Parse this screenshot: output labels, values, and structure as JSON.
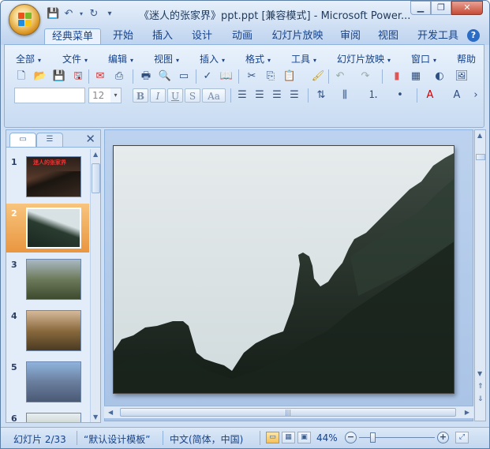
{
  "window": {
    "title": "《迷人的张家界》ppt.ppt [兼容模式] - Microsoft Power...",
    "controls": [
      "minimize-icon",
      "restore-icon",
      "close-icon"
    ]
  },
  "ribbon_tabs": [
    "经典菜单",
    "开始",
    "插入",
    "设计",
    "动画",
    "幻灯片放映",
    "审阅",
    "视图",
    "开发工具"
  ],
  "active_tab": "经典菜单",
  "classic_menus": [
    "全部",
    "文件",
    "编辑",
    "视图",
    "插入",
    "格式",
    "工具",
    "幻灯片放映",
    "窗口",
    "帮助"
  ],
  "format_bar": {
    "font_name": "",
    "font_size": "12",
    "buttons": [
      "B",
      "I",
      "U",
      "S",
      "Aa"
    ]
  },
  "slides_pane": {
    "tab_icons": [
      "slides-tab-icon",
      "outline-tab-icon"
    ],
    "close_symbol": "✕",
    "thumbnails": [
      {
        "num": "1",
        "title_text": "迷人的张家界"
      },
      {
        "num": "2"
      },
      {
        "num": "3"
      },
      {
        "num": "4"
      },
      {
        "num": "5"
      },
      {
        "num": "6"
      }
    ],
    "selected": "2"
  },
  "status_bar": {
    "slide_info": "幻灯片 2/33",
    "template": "“默认设计模板”",
    "language": "中文(简体，中国)",
    "zoom": "44%",
    "zoom_value": 0.44
  },
  "colors": {
    "accent": "#15428b",
    "selected_thumb": "#e99640",
    "ribbon_bg": "#d5e4f6"
  }
}
